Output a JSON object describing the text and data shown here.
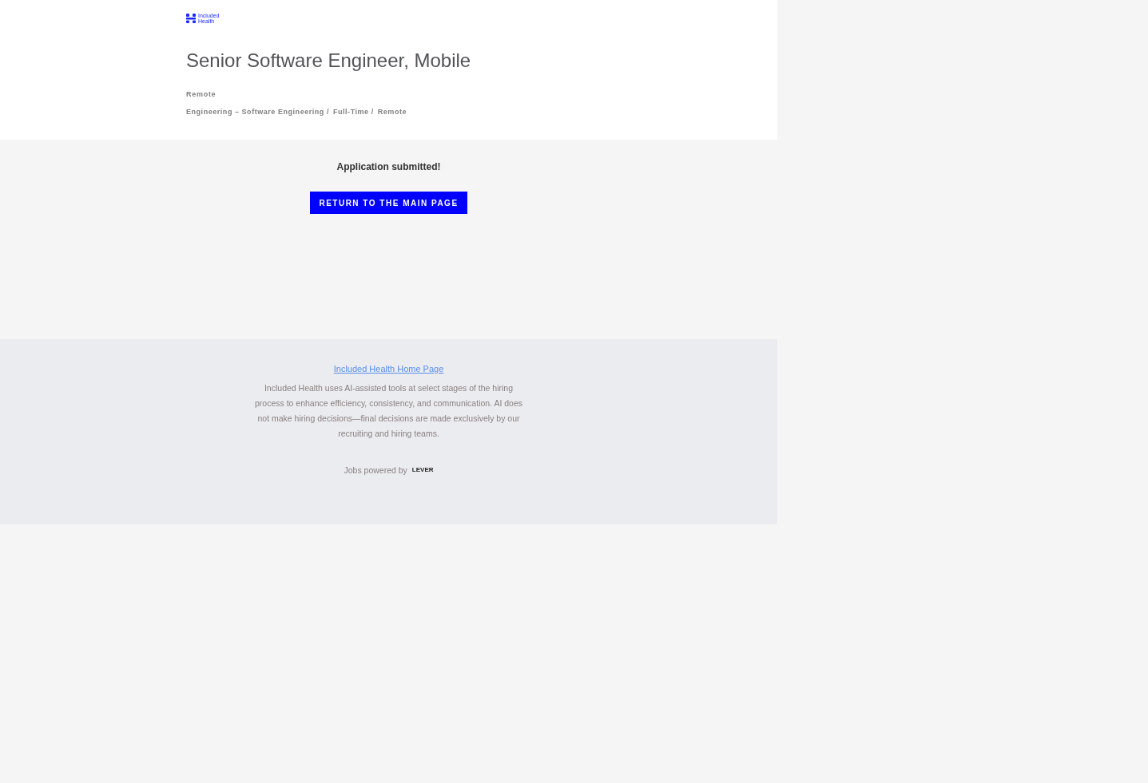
{
  "logo": {
    "text_line_1": "Included",
    "text_line_2": "Health"
  },
  "posting": {
    "title": "Senior Software Engineer, Mobile",
    "location": "Remote",
    "categories": [
      "Engineering – Software Engineering /",
      "Full-Time /",
      "Remote"
    ]
  },
  "confirmation": {
    "message": "Application submitted!",
    "button": "RETURN TO THE MAIN PAGE"
  },
  "footer": {
    "link": "Included Health Home Page",
    "disclaimer": "Included Health uses AI-assisted tools at select stages of the hiring process to enhance efficiency, consistency, and communication. AI does not make hiring decisions—final decisions are made exclusively by our recruiting and hiring teams.",
    "powered_by": "Jobs powered by",
    "brand": "LEVER"
  }
}
